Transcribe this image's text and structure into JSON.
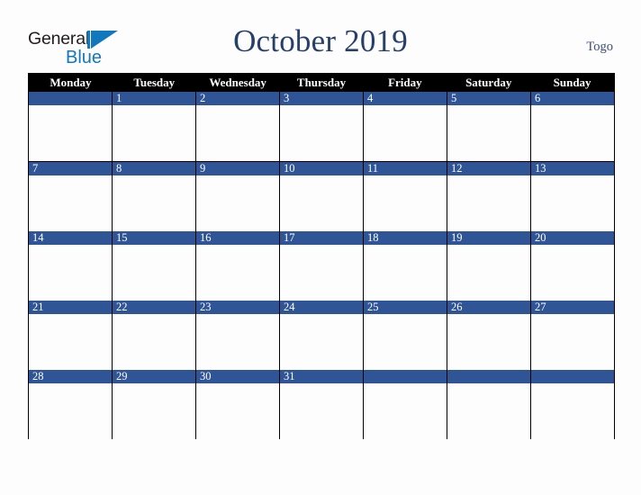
{
  "brand": {
    "word1": "General",
    "word2": "Blue",
    "mark_icon": "triangle-logo-icon",
    "color_dark": "#231f20",
    "color_blue": "#1278be"
  },
  "header": {
    "title": "October 2019",
    "region": "Togo",
    "title_color": "#27406b"
  },
  "calendar": {
    "month": "October",
    "year": "2019",
    "week_start": "Monday",
    "header_bg": "#000000",
    "header_text_color": "#ffffff",
    "daynum_bg": "#2f5597",
    "daynum_text_color": "#ffffff",
    "cell_bg": "#fdfdfd",
    "border_color": "#000000",
    "day_headers": [
      "Monday",
      "Tuesday",
      "Wednesday",
      "Thursday",
      "Friday",
      "Saturday",
      "Sunday"
    ],
    "weeks": [
      [
        "",
        "1",
        "2",
        "3",
        "4",
        "5",
        "6"
      ],
      [
        "7",
        "8",
        "9",
        "10",
        "11",
        "12",
        "13"
      ],
      [
        "14",
        "15",
        "16",
        "17",
        "18",
        "19",
        "20"
      ],
      [
        "21",
        "22",
        "23",
        "24",
        "25",
        "26",
        "27"
      ],
      [
        "28",
        "29",
        "30",
        "31",
        "",
        "",
        ""
      ]
    ]
  }
}
